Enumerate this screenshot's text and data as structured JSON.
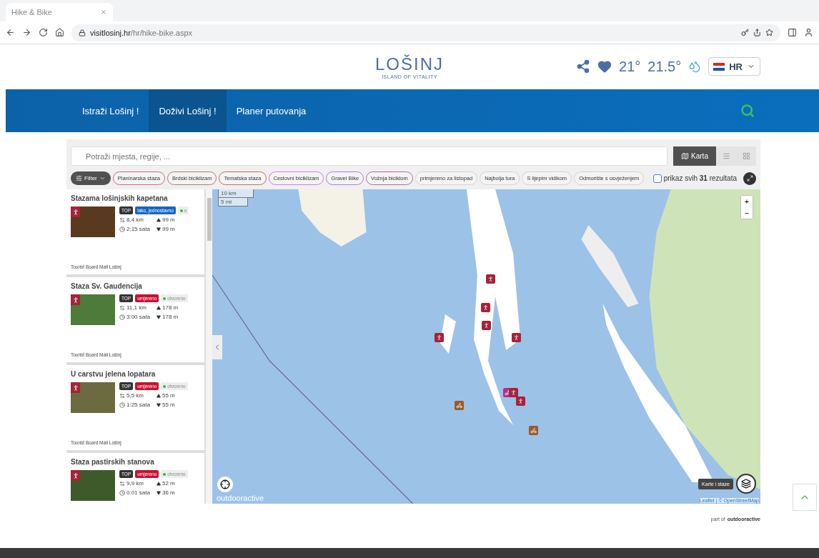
{
  "browser": {
    "tab_title": "Hike & Bike",
    "url_host": "visitlosinj.hr",
    "url_path": "/hr/hike-bike.aspx"
  },
  "header": {
    "logo": "LOŠINJ",
    "tagline": "ISLAND OF VITALITY",
    "air_temp": "21°",
    "sea_temp": "21.5°",
    "language": "HR"
  },
  "nav": [
    {
      "label": "Istraži Lošinj !",
      "selected": false
    },
    {
      "label": "Doživi Lošinj !",
      "selected": true
    },
    {
      "label": "Planer putovanja",
      "selected": false
    }
  ],
  "search": {
    "placeholder": "Potraži mjesta, regije, ..."
  },
  "views": [
    {
      "kind": "map",
      "label": "Karta",
      "selected": true
    },
    {
      "kind": "list",
      "selected": false
    },
    {
      "kind": "grid",
      "selected": false
    }
  ],
  "filter_button": "Filter",
  "chips": [
    {
      "label": "Planinarska staza",
      "color": "#c96a7e"
    },
    {
      "label": "Brdski biciklizam",
      "color": "#a8816a"
    },
    {
      "label": "Tematska staza",
      "color": "#c0705a"
    },
    {
      "label": "Cestovni biciklizam",
      "color": "#d97be0"
    },
    {
      "label": "Gravel Bike",
      "color": "#a77fe0"
    },
    {
      "label": "Vožnja biciklom",
      "color": "#b06aa8"
    },
    {
      "label": "primjereno za listopad",
      "color": "#d4d4d4"
    },
    {
      "label": "Najbolja tura",
      "color": "#d4d4d4"
    },
    {
      "label": "S lijepim vidikom",
      "color": "#d4d4d4"
    },
    {
      "label": "Odmorište s osvježenjem",
      "color": "#d4d4d4"
    }
  ],
  "show_all": {
    "checked": false,
    "text": "prikaz svih **31** rezultata"
  },
  "tours": [
    {
      "title": "Stazama lošinjskih kapetana",
      "top": "TOP",
      "difficulty": "lako, jednostavno",
      "color": "#1565c0",
      "status": "o",
      "distance": "8,4 km",
      "ascent": "99 m",
      "duration": "2:15 sata",
      "descent": "99 m",
      "author": "Tourist Board Mali Lošinj"
    },
    {
      "title": "Staza Sv. Gaudencija",
      "top": "TOP",
      "difficulty": "umjereno",
      "color": "#c8102e",
      "status": "otvoreno",
      "distance": "11,1 km",
      "ascent": "178 m",
      "duration": "3:00 sata",
      "descent": "178 m",
      "author": "Tourist Board Mali Lošinj"
    },
    {
      "title": "U carstvu jelena lopatara",
      "top": "TOP",
      "difficulty": "umjereno",
      "color": "#c8102e",
      "status": "otvoreno",
      "distance": "5,5 km",
      "ascent": "55 m",
      "duration": "1:25 sata",
      "descent": "55 m",
      "author": "Tourist Board Mali Lošinj"
    },
    {
      "title": "Staza pastirskih stanova",
      "top": "TOP",
      "difficulty": "umjereno",
      "color": "#c8102e",
      "status": "otvoreno",
      "distance": "9,9 km",
      "ascent": "52 m",
      "duration": "0:01 sata",
      "descent": "36 m"
    }
  ],
  "map": {
    "scale_km": "10 km",
    "scale_mi": "5 mi",
    "zoom_in": "+",
    "zoom_out": "−",
    "brand": "outdooractive",
    "layers_tooltip": "Karte i staze",
    "attribution": "Leaflet | © OpenStreetMap"
  },
  "footer": {
    "prefix": "part of",
    "brand": "outdooractive"
  }
}
